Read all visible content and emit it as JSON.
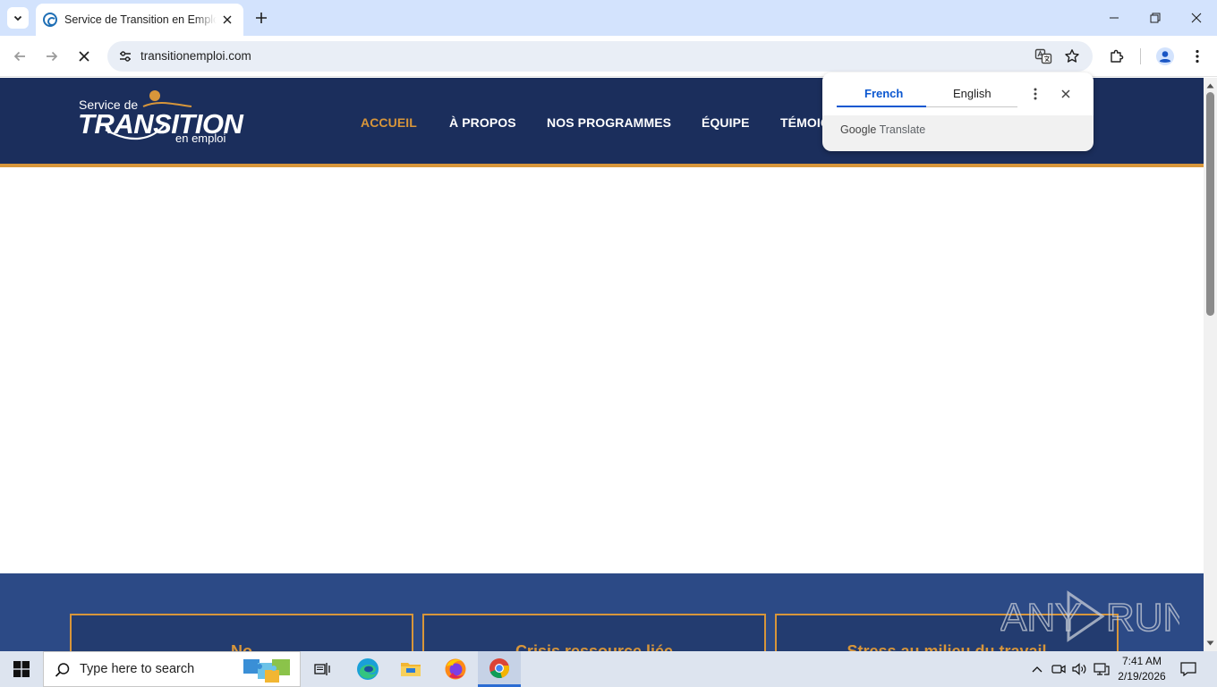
{
  "browser": {
    "tab": {
      "title": "Service de Transition en Emploi",
      "close_label": "×"
    },
    "url": "transitionemploi.com"
  },
  "site": {
    "logo": {
      "line1": "Service de",
      "line2": "TRANSITION",
      "line3": "en emploi"
    },
    "nav": [
      {
        "label": "ACCUEIL",
        "active": true
      },
      {
        "label": "À PROPOS",
        "active": false
      },
      {
        "label": "NOS PROGRAMMES",
        "active": false
      },
      {
        "label": "ÉQUIPE",
        "active": false
      },
      {
        "label": "TÉMOIG",
        "active": false
      }
    ],
    "cards": [
      {
        "title": "No"
      },
      {
        "title": "Crisis ressource liée"
      },
      {
        "title": "Stress au milieu du travail"
      }
    ],
    "watermark": "ANY RUN"
  },
  "translate_popup": {
    "source_lang": "French",
    "target_lang": "English",
    "brand_google": "Google",
    "brand_translate": "Translate"
  },
  "taskbar": {
    "search_placeholder": "Type here to search",
    "time": "7:41 AM",
    "date": "2/19/2026"
  },
  "colors": {
    "header_navy": "#1b2e5c",
    "accent_gold": "#d8963a",
    "band_blue": "#2c4a86",
    "chrome_tabstrip": "#d3e3fd",
    "translate_blue": "#0b57d0"
  }
}
